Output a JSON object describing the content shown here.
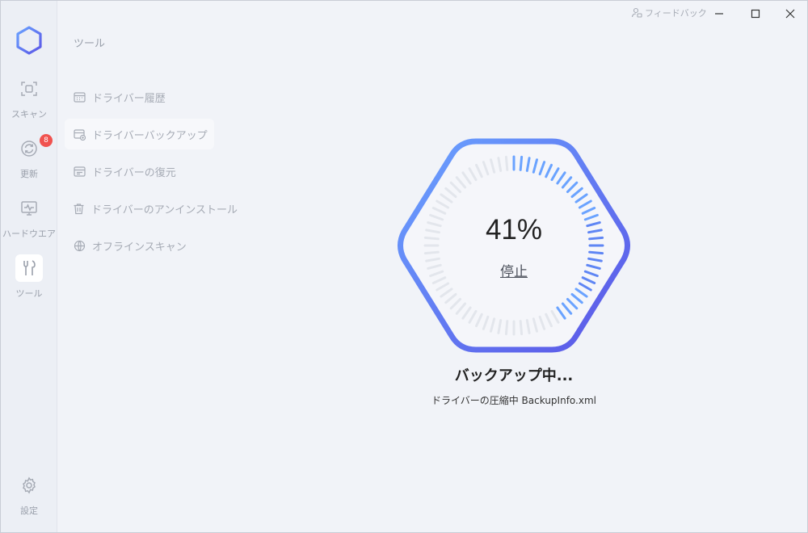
{
  "titlebar": {
    "feedback_label": "フィードバック"
  },
  "rail": {
    "items": [
      {
        "label": "スキャン",
        "icon": "scan-icon"
      },
      {
        "label": "更新",
        "icon": "refresh-icon",
        "badge": "8"
      },
      {
        "label": "ハードウエア",
        "icon": "monitor-pulse-icon"
      },
      {
        "label": "ツール",
        "icon": "tools-icon",
        "active": true
      }
    ],
    "settings_label": "設定"
  },
  "panel": {
    "title": "ツール",
    "items": [
      {
        "label": "ドライバー履歴",
        "icon": "calendar-list-icon"
      },
      {
        "label": "ドライバーバックアップ",
        "icon": "backup-icon",
        "active": true
      },
      {
        "label": "ドライバーの復元",
        "icon": "restore-icon"
      },
      {
        "label": "ドライバーのアンインストール",
        "icon": "trash-icon"
      },
      {
        "label": "オフラインスキャン",
        "icon": "globe-icon"
      }
    ]
  },
  "progress": {
    "percent_text": "41%",
    "percent_value": 41,
    "stop_label": "停止",
    "status_title": "バックアップ中...",
    "status_detail": "ドライバーの圧縮中 BackupInfo.xml"
  },
  "colors": {
    "accent_start": "#6aa3ff",
    "accent_end": "#5b55e6",
    "badge": "#f0524f",
    "tick_inactive": "#e3e6ec"
  }
}
